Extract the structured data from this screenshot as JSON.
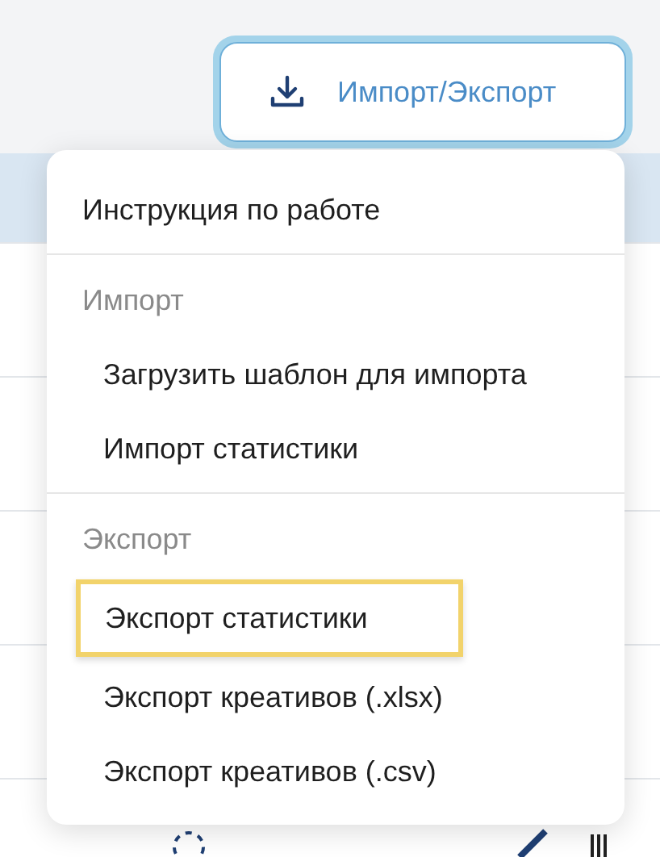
{
  "button": {
    "label": "Импорт/Экспорт",
    "focused": true
  },
  "menu": {
    "sections": [
      {
        "items": [
          {
            "label": "Инструкция по работе",
            "selected": false
          }
        ]
      },
      {
        "title": "Импорт",
        "items": [
          {
            "label": "Загрузить шаблон для импорта",
            "selected": false
          },
          {
            "label": "Импорт статистики",
            "selected": false
          }
        ]
      },
      {
        "title": "Экспорт",
        "items": [
          {
            "label": "Экспорт статистики",
            "selected": true
          },
          {
            "label": "Экспорт креативов (.xlsx)",
            "selected": false
          },
          {
            "label": "Экспорт креативов (.csv)",
            "selected": false
          }
        ]
      }
    ]
  }
}
